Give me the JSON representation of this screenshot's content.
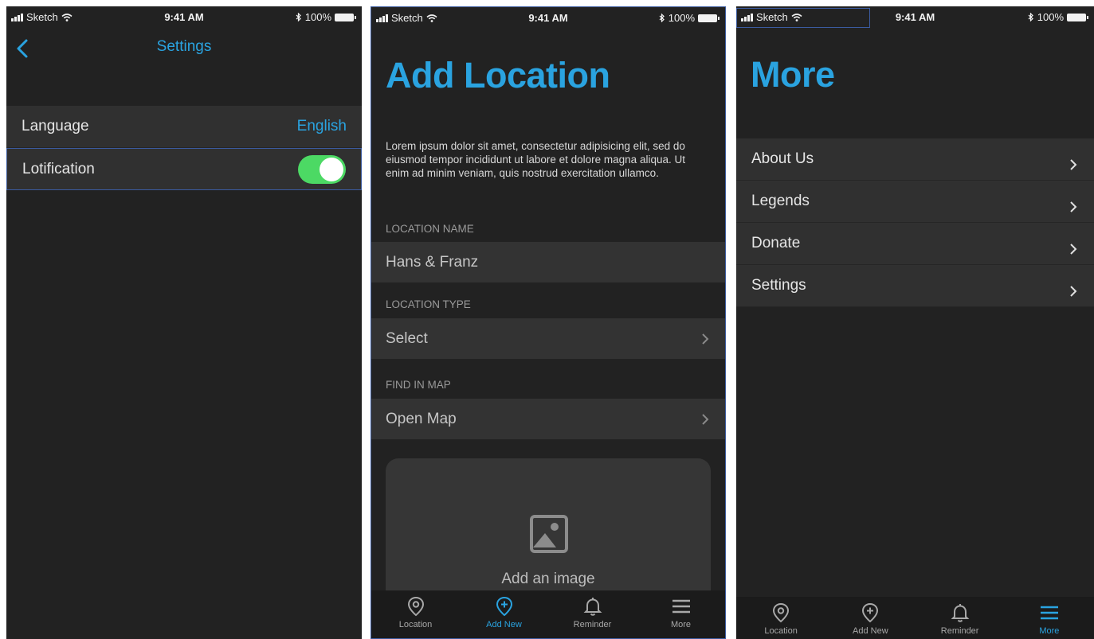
{
  "status_bar": {
    "carrier": "Sketch",
    "time": "9:41 AM",
    "battery": "100%"
  },
  "settings_screen": {
    "title": "Settings",
    "rows": [
      {
        "label": "Language",
        "value": "English"
      },
      {
        "label": "Lotification",
        "toggle": "on"
      }
    ]
  },
  "add_location_screen": {
    "title": "Add Location",
    "description": "Lorem ipsum dolor sit amet, consectetur adipisicing elit, sed do eiusmod tempor incididunt ut labore et dolore magna aliqua. Ut enim ad minim veniam, quis nostrud exercitation ullamco.",
    "location_name": {
      "label": "LOCATION NAME",
      "value": "Hans & Franz"
    },
    "location_type": {
      "label": "LOCATION TYPE",
      "value": "Select"
    },
    "find_in_map": {
      "label": "FIND IN MAP",
      "value": "Open Map"
    },
    "image_card": {
      "label": "Add an image"
    }
  },
  "more_screen": {
    "title": "More",
    "items": [
      "About Us",
      "Legends",
      "Donate",
      "Settings"
    ]
  },
  "tab_bar": {
    "tabs": [
      {
        "label": "Location",
        "icon": "location-pin-icon"
      },
      {
        "label": "Add New",
        "icon": "add-location-icon"
      },
      {
        "label": "Reminder",
        "icon": "bell-icon"
      },
      {
        "label": "More",
        "icon": "menu-icon"
      }
    ]
  },
  "colors": {
    "accent": "#2aa3e0",
    "background": "#222222",
    "row": "#303030",
    "toggle_on": "#4cd964",
    "selection_outline": "#3b5ba0"
  }
}
